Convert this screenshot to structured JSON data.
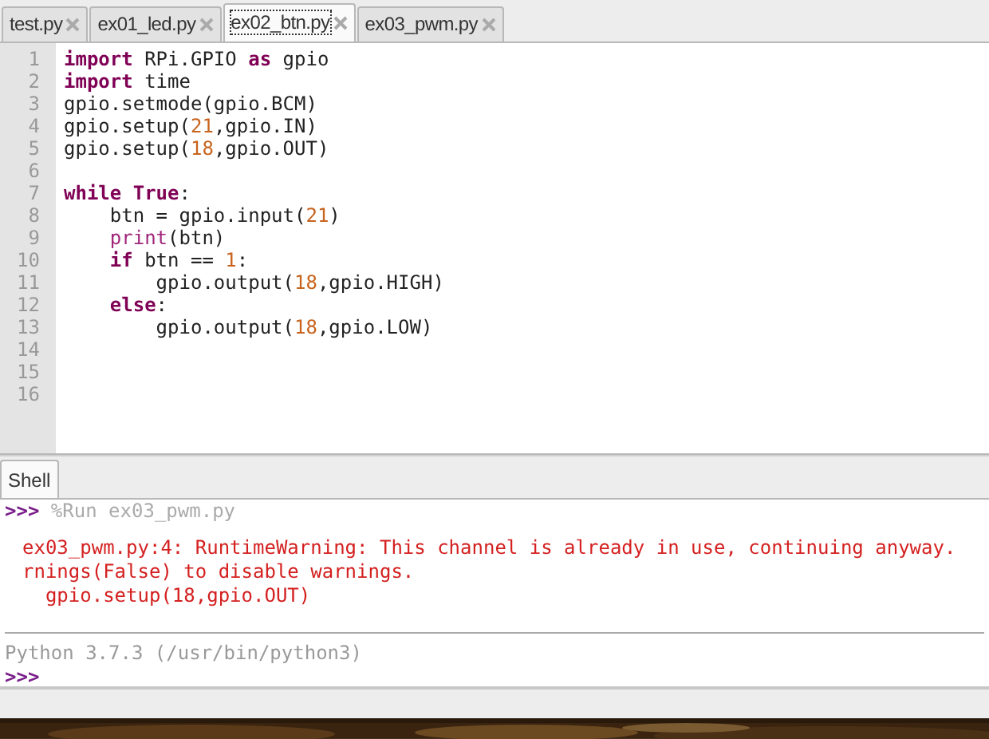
{
  "editor_tabs": [
    {
      "label": "test.py",
      "selected": false
    },
    {
      "label": "ex01_led.py",
      "selected": false
    },
    {
      "label": "ex02_btn.py",
      "selected": true
    },
    {
      "label": "ex03_pwm.py",
      "selected": false
    }
  ],
  "editor": {
    "lines": [
      {
        "number": "1",
        "tokens": [
          {
            "text": "import",
            "kind": "keyword"
          },
          {
            "text": " RPi.GPIO ",
            "kind": "plain"
          },
          {
            "text": "as",
            "kind": "keyword"
          },
          {
            "text": " gpio",
            "kind": "plain"
          }
        ]
      },
      {
        "number": "2",
        "tokens": [
          {
            "text": "import",
            "kind": "keyword"
          },
          {
            "text": " time",
            "kind": "plain"
          }
        ]
      },
      {
        "number": "3",
        "tokens": [
          {
            "text": "gpio.setmode(gpio.BCM)",
            "kind": "plain"
          }
        ]
      },
      {
        "number": "4",
        "tokens": [
          {
            "text": "gpio.setup(",
            "kind": "plain"
          },
          {
            "text": "21",
            "kind": "number"
          },
          {
            "text": ",gpio.IN)",
            "kind": "plain"
          }
        ]
      },
      {
        "number": "5",
        "tokens": [
          {
            "text": "gpio.setup(",
            "kind": "plain"
          },
          {
            "text": "18",
            "kind": "number"
          },
          {
            "text": ",gpio.OUT)",
            "kind": "plain"
          }
        ]
      },
      {
        "number": "6"
      },
      {
        "number": "7",
        "tokens": [
          {
            "text": "while True",
            "kind": "keyword"
          },
          {
            "text": ":",
            "kind": "plain"
          }
        ]
      },
      {
        "number": "8",
        "tokens": [
          {
            "text": "    btn = gpio.input(",
            "kind": "plain"
          },
          {
            "text": "21",
            "kind": "number"
          },
          {
            "text": ")",
            "kind": "plain"
          }
        ]
      },
      {
        "number": "9",
        "tokens": [
          {
            "text": "    print",
            "kind": "builtin"
          },
          {
            "text": "(btn)",
            "kind": "plain"
          }
        ]
      },
      {
        "number": "10",
        "tokens": [
          {
            "text": "    if",
            "kind": "keyword"
          },
          {
            "text": " btn == ",
            "kind": "plain"
          },
          {
            "text": "1",
            "kind": "number"
          },
          {
            "text": ":",
            "kind": "plain"
          }
        ]
      },
      {
        "number": "11",
        "tokens": [
          {
            "text": "        gpio.output(",
            "kind": "plain"
          },
          {
            "text": "18",
            "kind": "number"
          },
          {
            "text": ",gpio.HIGH)",
            "kind": "plain"
          }
        ]
      },
      {
        "number": "12",
        "tokens": [
          {
            "text": "    else",
            "kind": "keyword"
          },
          {
            "text": ":",
            "kind": "plain"
          }
        ]
      },
      {
        "number": "13",
        "tokens": [
          {
            "text": "        gpio.output(",
            "kind": "plain"
          },
          {
            "text": "18",
            "kind": "number"
          },
          {
            "text": ",gpio.LOW)",
            "kind": "plain"
          }
        ]
      },
      {
        "number": "14"
      },
      {
        "number": "15"
      },
      {
        "number": "16"
      }
    ]
  },
  "shell_tabs": [
    {
      "label": "Shell",
      "selected": true
    }
  ],
  "shell": {
    "lines": [
      {
        "kind": "command",
        "prompt": ">>>",
        "text": "%Run ex03_pwm.py"
      },
      {
        "kind": "blank"
      },
      {
        "kind": "error",
        "text": "ex03_pwm.py:4: RuntimeWarning: This channel is already in use, continuing anyway."
      },
      {
        "kind": "error",
        "text": "rnings(False) to disable warnings."
      },
      {
        "kind": "error",
        "text": "  gpio.setup(18,gpio.OUT)"
      },
      {
        "kind": "blank"
      },
      {
        "kind": "separator"
      },
      {
        "kind": "info",
        "text": "Python 3.7.3 (/usr/bin/python3)"
      },
      {
        "kind": "prompt",
        "prompt": ">>>"
      }
    ]
  }
}
